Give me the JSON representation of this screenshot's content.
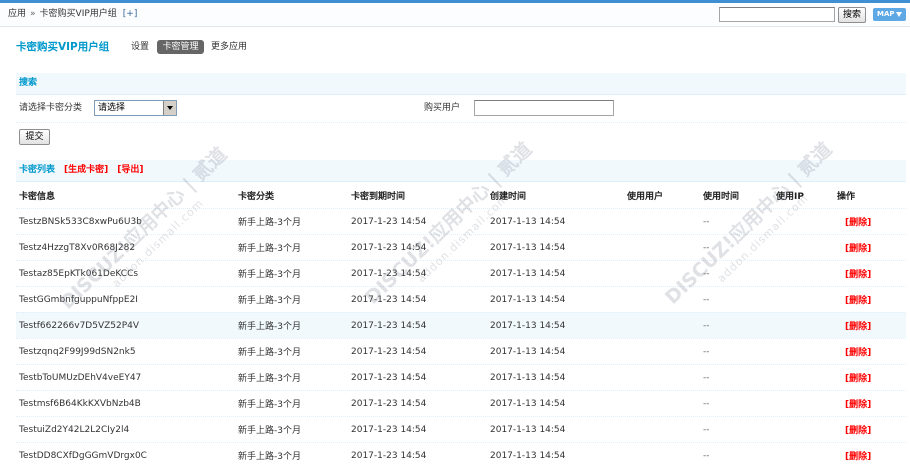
{
  "colors": {
    "top_strip": "#3F8FD2",
    "accent": "#0099CC",
    "danger": "#FF0000",
    "band_bg": "#F2F9FD",
    "band_border": "#DEEFFB",
    "tab_active_bg": "#666666",
    "map_bg": "#5FA8E6",
    "link": "#336699",
    "highlight_row_bg": "#F2F9FD",
    "text": "#333333"
  },
  "icons": {
    "map_arrow": "arrow-down-icon",
    "select_arrow": "chevron-down-icon"
  },
  "breadcrumb": {
    "app": "应用",
    "separator": "»",
    "current": "卡密购买VIP用户组",
    "add": "[+]"
  },
  "top_search": {
    "button": "搜索",
    "map": "MAP"
  },
  "header": {
    "title": "卡密购买VIP用户组",
    "tabs": [
      {
        "label": "设置",
        "active": false
      },
      {
        "label": "卡密管理",
        "active": true
      },
      {
        "label": "更多应用",
        "active": false
      }
    ]
  },
  "search_form": {
    "title": "搜索",
    "category_label": "请选择卡密分类",
    "category_selected": "请选择",
    "buyer_label": "购买用户",
    "submit": "提交"
  },
  "card_list": {
    "title": "卡密列表",
    "generate": "[生成卡密]",
    "export": "[导出]",
    "columns": [
      "卡密信息",
      "卡密分类",
      "卡密到期时间",
      "创建时间",
      "使用用户",
      "使用时间",
      "使用IP",
      "操作"
    ],
    "rows": [
      {
        "key": "TestzBNSk533C8xwPu6U3b",
        "category": "新手上路-3个月",
        "expires": "2017-1-23 14:54",
        "created": "2017-1-13 14:54",
        "used_time": "--",
        "action": "[删除]"
      },
      {
        "key": "Testz4HzzgT8Xv0R68J282",
        "category": "新手上路-3个月",
        "expires": "2017-1-23 14:54",
        "created": "2017-1-13 14:54",
        "used_time": "--",
        "action": "[删除]"
      },
      {
        "key": "Testaz85EpKTk061DeKCCs",
        "category": "新手上路-3个月",
        "expires": "2017-1-23 14:54",
        "created": "2017-1-13 14:54",
        "used_time": "--",
        "action": "[删除]"
      },
      {
        "key": "TestGGmbnfguppuNfppE2I",
        "category": "新手上路-3个月",
        "expires": "2017-1-23 14:54",
        "created": "2017-1-13 14:54",
        "used_time": "--",
        "action": "[删除]"
      },
      {
        "key": "Testf662266v7D5VZ52P4V",
        "category": "新手上路-3个月",
        "expires": "2017-1-23 14:54",
        "created": "2017-1-13 14:54",
        "used_time": "--",
        "action": "[删除]",
        "highlighted": true
      },
      {
        "key": "Testzqnq2F99J99dSN2nk5",
        "category": "新手上路-3个月",
        "expires": "2017-1-23 14:54",
        "created": "2017-1-13 14:54",
        "used_time": "--",
        "action": "[删除]"
      },
      {
        "key": "TestbToUMUzDEhV4veEY47",
        "category": "新手上路-3个月",
        "expires": "2017-1-23 14:54",
        "created": "2017-1-13 14:54",
        "used_time": "--",
        "action": "[删除]"
      },
      {
        "key": "Testmsf6B64KkKXVbNzb4B",
        "category": "新手上路-3个月",
        "expires": "2017-1-23 14:54",
        "created": "2017-1-13 14:54",
        "used_time": "--",
        "action": "[删除]"
      },
      {
        "key": "TestuiZd2Y42L2L2CIy2l4",
        "category": "新手上路-3个月",
        "expires": "2017-1-23 14:54",
        "created": "2017-1-13 14:54",
        "used_time": "--",
        "action": "[删除]"
      },
      {
        "key": "TestDD8CXfDgGGmVDrgx0C",
        "category": "新手上路-3个月",
        "expires": "2017-1-23 14:54",
        "created": "2017-1-13 14:54",
        "used_time": "--",
        "action": "[删除]"
      }
    ]
  },
  "watermark": {
    "brand": "DISCUZ!应用中心 | 贰道",
    "site": "addon.dismall.com"
  }
}
